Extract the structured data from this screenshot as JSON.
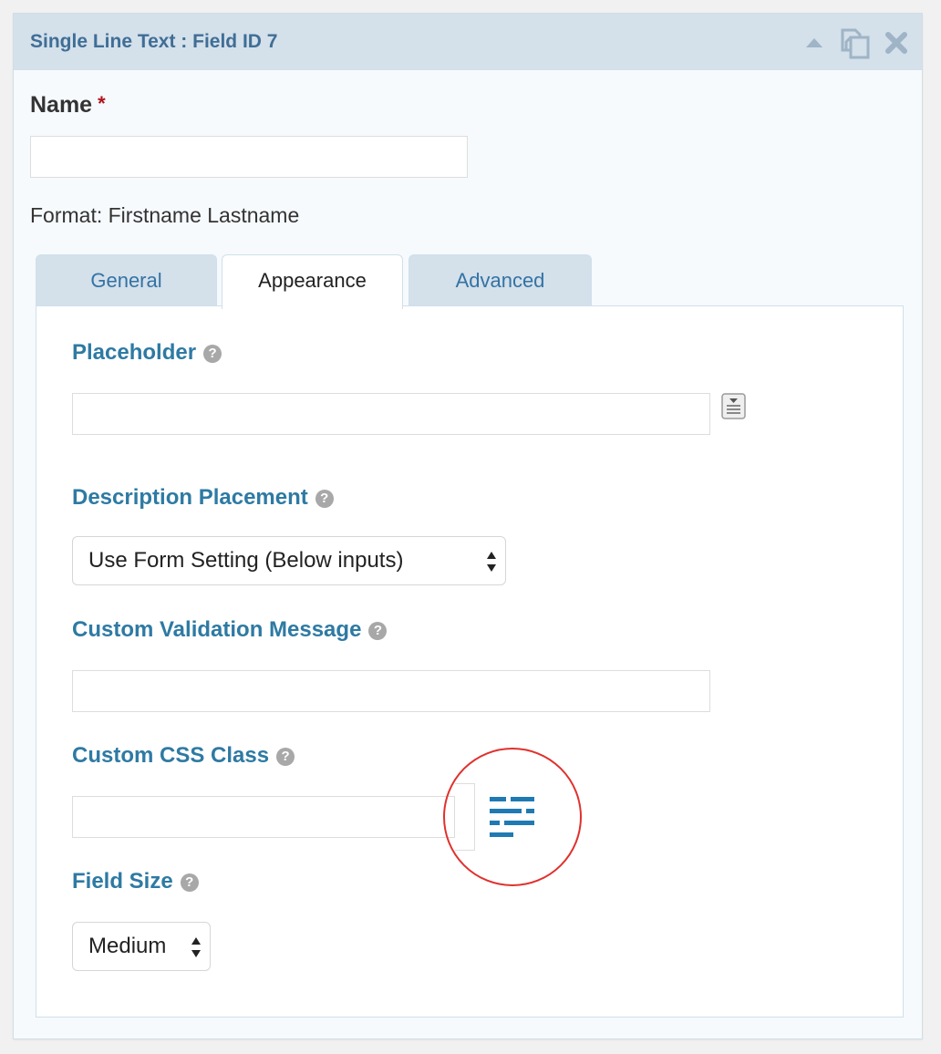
{
  "panel": {
    "title": "Single Line Text : Field ID 7",
    "icons": [
      "collapse-arrow-icon",
      "duplicate-icon",
      "close-icon"
    ],
    "colors": {
      "header_bg": "#d4e0ea",
      "title": "#3f6e96",
      "label": "#2e7aa3",
      "highlight": "#e0312d"
    }
  },
  "preview": {
    "label": "Name",
    "required_mark": "*",
    "value": "",
    "format": "Format: Firstname Lastname"
  },
  "tabs": [
    {
      "label": "General",
      "active": false
    },
    {
      "label": "Appearance",
      "active": true
    },
    {
      "label": "Advanced",
      "active": false
    }
  ],
  "settings": {
    "placeholder": {
      "label": "Placeholder",
      "help": "?",
      "value": ""
    },
    "description_placement": {
      "label": "Description Placement",
      "help": "?",
      "selected": "Use Form Setting (Below inputs)"
    },
    "validation_message": {
      "label": "Custom Validation Message",
      "help": "?",
      "value": ""
    },
    "css_class": {
      "label": "Custom CSS Class",
      "help": "?",
      "value": ""
    },
    "field_size": {
      "label": "Field Size",
      "help": "?",
      "selected": "Medium"
    }
  }
}
